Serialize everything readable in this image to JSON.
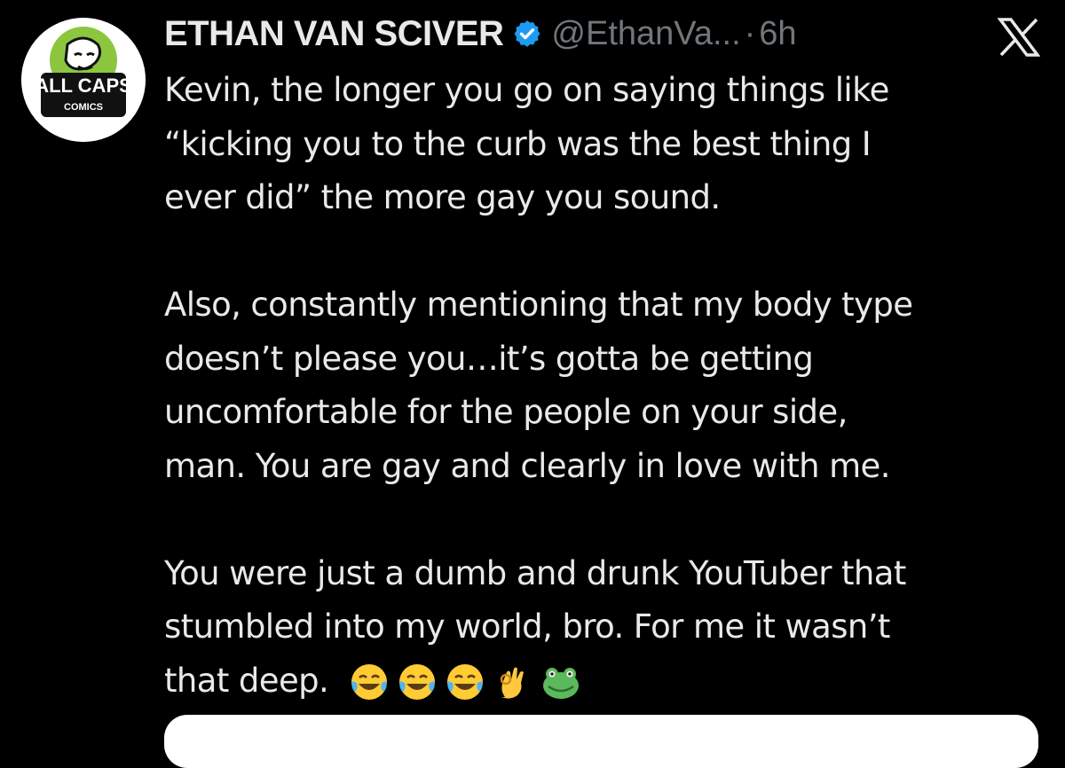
{
  "tweet": {
    "author": {
      "display_name": "ETHAN VAN SCIVER",
      "handle": "@EthanVa...",
      "verified": true,
      "avatar_text": "ALL CAPS",
      "avatar_subtext": "COMICS"
    },
    "separator": "·",
    "time": "6h",
    "lines": [
      "Kevin, the longer you go on saying things like",
      "“kicking you to the curb was the best thing I",
      "ever did” the more gay you sound.",
      "",
      "Also, constantly mentioning that my body type",
      "doesn’t please you…it’s gotta be getting",
      "uncomfortable for the people on your side,",
      "man. You are gay and clearly in love with me.",
      "",
      "You were just a dumb and drunk YouTuber that",
      "stumbled into my world, bro.  For me it wasn’t"
    ],
    "last_line": "that deep.",
    "emojis": [
      "face-with-tears-of-joy",
      "face-with-tears-of-joy",
      "face-with-tears-of-joy",
      "ok-hand",
      "frog-face"
    ]
  },
  "colors": {
    "background": "#000000",
    "text": "#e7e9ea",
    "muted": "#71767b",
    "verified": "#1d9bf0",
    "avatar_green": "#8cc63f"
  },
  "icons": {
    "platform_logo": "x-logo",
    "verified_badge": "verified-badge-icon"
  }
}
